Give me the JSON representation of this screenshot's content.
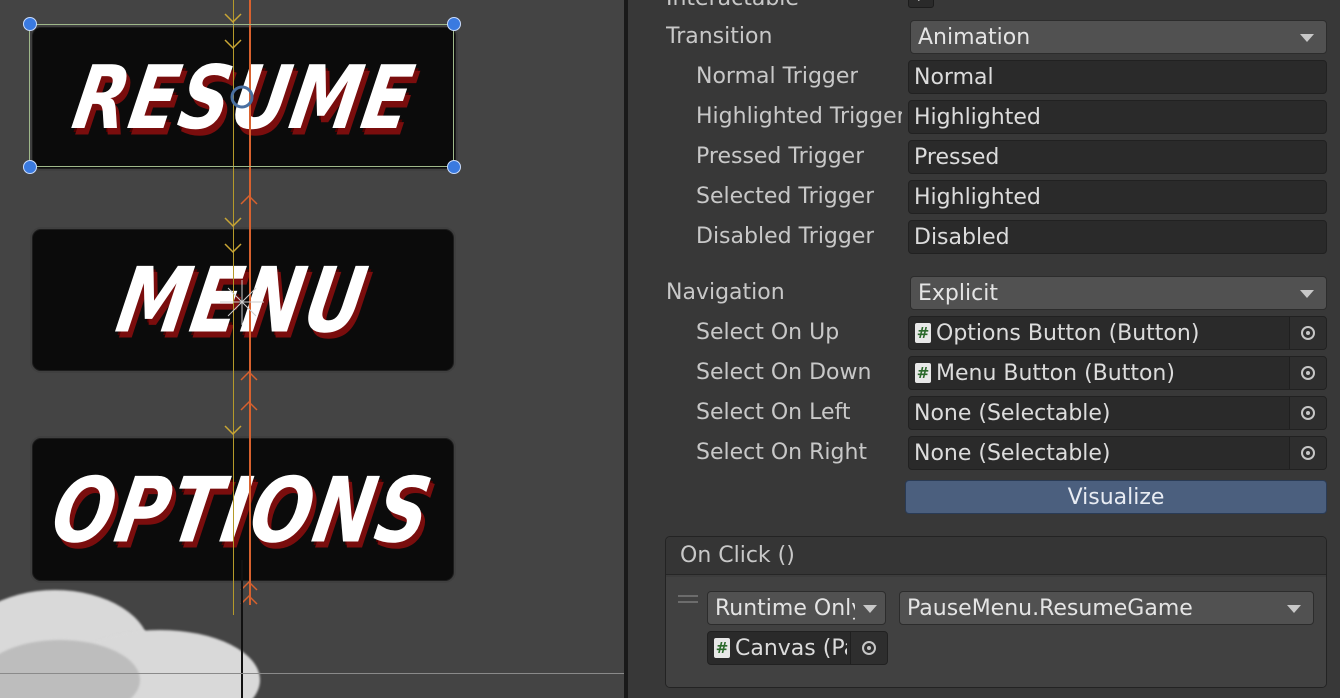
{
  "scene": {
    "buttons": [
      {
        "label": "RESUME"
      },
      {
        "label": "MENU"
      },
      {
        "label": "OPTIONS"
      }
    ]
  },
  "inspector": {
    "interactable_label": "Interactable",
    "transition": {
      "label": "Transition",
      "value": "Animation"
    },
    "triggers": [
      {
        "label": "Normal Trigger",
        "value": "Normal"
      },
      {
        "label": "Highlighted Trigger",
        "value": "Highlighted"
      },
      {
        "label": "Pressed Trigger",
        "value": "Pressed"
      },
      {
        "label": "Selected Trigger",
        "value": "Highlighted"
      },
      {
        "label": "Disabled Trigger",
        "value": "Disabled"
      }
    ],
    "navigation": {
      "label": "Navigation",
      "value": "Explicit"
    },
    "select": [
      {
        "label": "Select On Up",
        "value": "Options Button (Button)",
        "icon": "script-icon"
      },
      {
        "label": "Select On Down",
        "value": "Menu Button (Button)",
        "icon": "script-icon"
      },
      {
        "label": "Select On Left",
        "value": "None (Selectable)",
        "icon": ""
      },
      {
        "label": "Select On Right",
        "value": "None (Selectable)",
        "icon": ""
      }
    ],
    "visualize_label": "Visualize",
    "on_click": {
      "header": "On Click ()",
      "runtime": "Runtime Only",
      "function": "PauseMenu.ResumeGame",
      "target": "Canvas (PauseMenu)"
    }
  },
  "colors": {
    "accent": "#4b5f7e",
    "selection_handle": "#3a7ae0",
    "nav_up_arrow": "#c9a635",
    "nav_down_arrow": "#e0703a"
  }
}
